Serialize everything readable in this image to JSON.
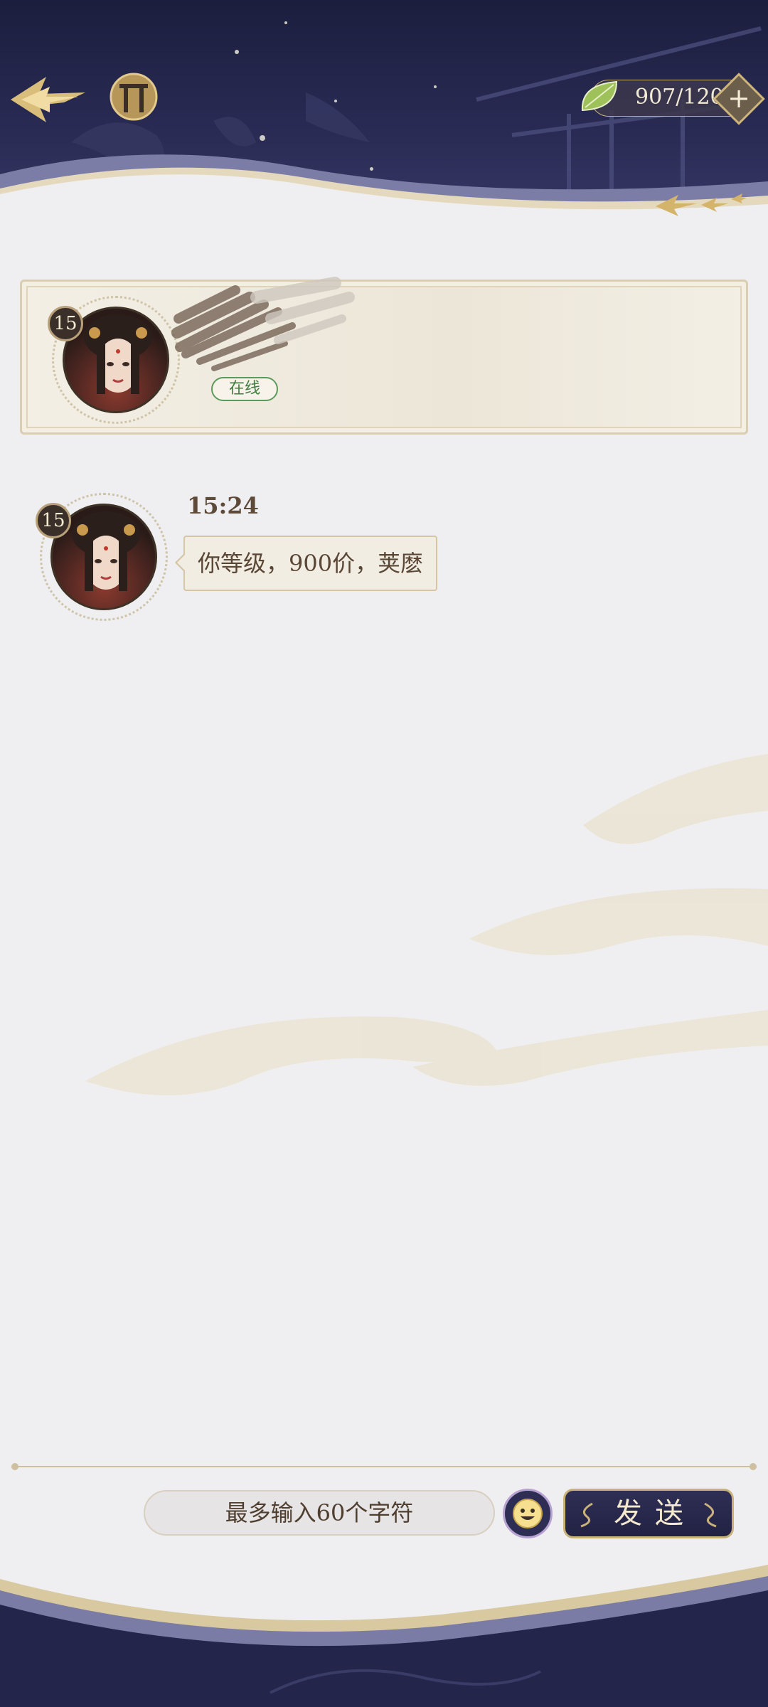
{
  "header": {
    "leaf_count": "907/120",
    "plus_label": "+",
    "icons": {
      "back": "arrow-back-icon",
      "home": "gate-home-icon",
      "currency": "leaf-icon"
    }
  },
  "profile": {
    "level": "15",
    "status": "在线"
  },
  "chat": {
    "messages": [
      {
        "sender_level": "15",
        "time": "15:24",
        "text": "你等级，900价，荚麽"
      }
    ]
  },
  "input_bar": {
    "placeholder": "最多输入60个字符",
    "send_label": "发送",
    "emoji_icon": "smiley-face-icon"
  },
  "colors": {
    "header_bg": "#23254a",
    "gold": "#c9b27a",
    "online_green": "#3f7e3f",
    "text_brown": "#5a4635"
  }
}
